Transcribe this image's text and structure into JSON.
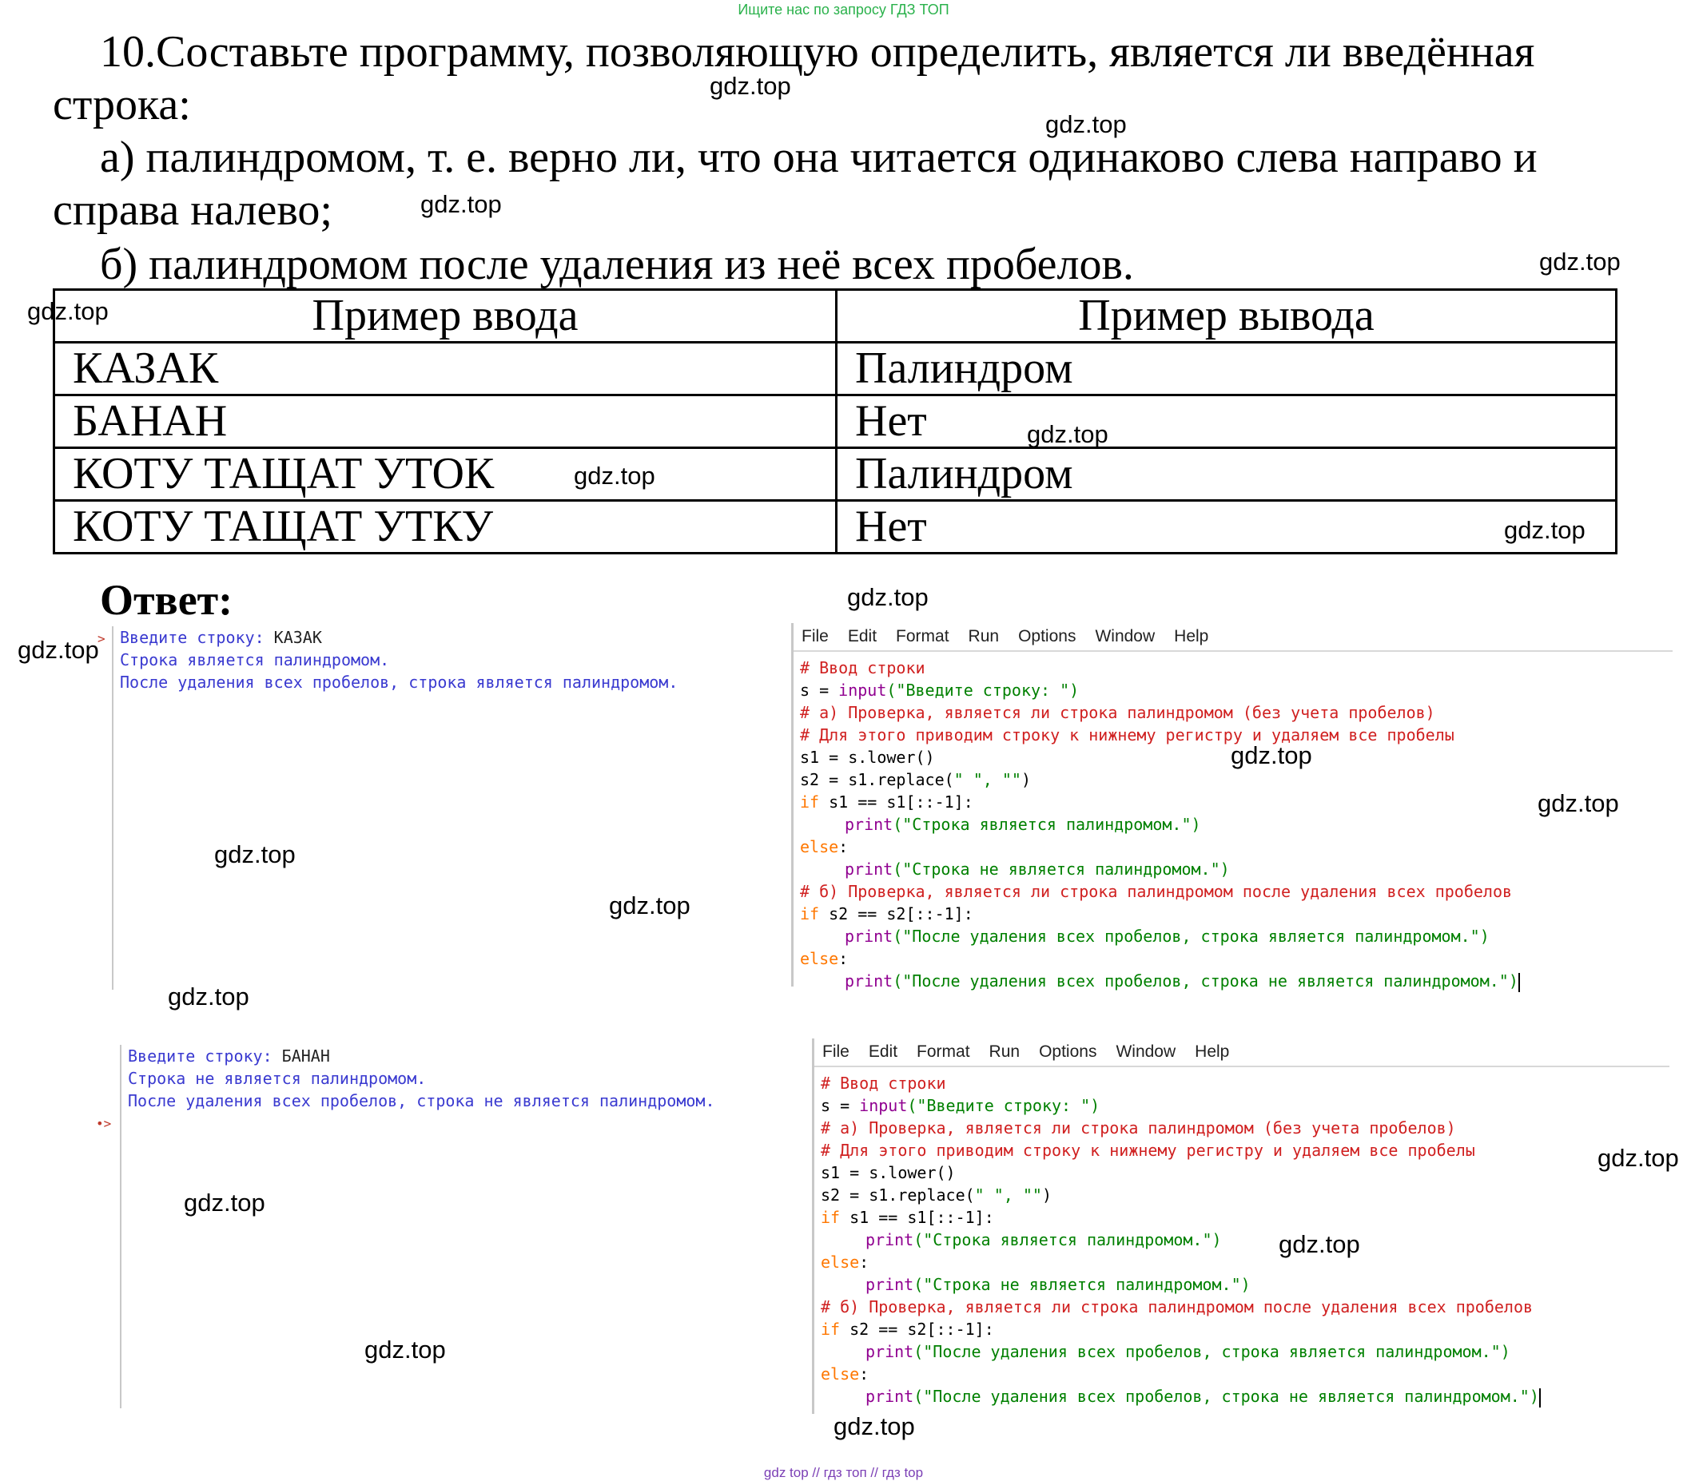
{
  "banner": "Ищите нас по запросу ГДЗ ТОП",
  "task": {
    "line1": "10.Составьте программу, позволяющую определить, является ли введённая",
    "line2": "строка:",
    "line3": "а)  палиндромом, т. е. верно ли, что она читается одинаково слева направо и",
    "line4": "справа налево;",
    "line5": "б)  палиндромом после удаления из неё всех пробелов."
  },
  "table": {
    "headers": [
      "Пример ввода",
      "Пример вывода"
    ],
    "rows": [
      [
        "КАЗАК",
        "Палиндром"
      ],
      [
        "БАНАН",
        "Нет"
      ],
      [
        "КОТУ ТАЩАТ УТОК",
        "Палиндром"
      ],
      [
        "КОТУ ТАЩАТ УТКУ",
        "Нет"
      ]
    ]
  },
  "answer_label": "Ответ:",
  "shell1": {
    "prompt_label": "Введите строку: ",
    "input_value": "КАЗАК",
    "out1": "Строка является палиндромом.",
    "out2": "После удаления всех пробелов, строка является палиндромом.",
    "prompt_marker": ">"
  },
  "shell2": {
    "prompt_label": "Введите строку: ",
    "input_value": "БАНАН",
    "out1": "Строка не является палиндромом.",
    "out2": "После удаления всех пробелов, строка не является палиндромом.",
    "prompt_marker": "•>"
  },
  "menu": [
    "File",
    "Edit",
    "Format",
    "Run",
    "Options",
    "Window",
    "Help"
  ],
  "code": {
    "c1": "# Ввод строки",
    "l2a": "s = ",
    "l2fn": "input",
    "l2str": "(\"Введите строку: \")",
    "c3": "# а) Проверка, является ли строка палиндромом (без учета пробелов)",
    "c4": "# Для этого приводим строку к нижнему регистру и удаляем все пробелы",
    "l5": "s1 = s.lower()",
    "l6a": "s2 = s1.replace(",
    "l6str": "\" \", \"\"",
    "l6b": ")",
    "kw_if": "if",
    "l7": " s1 == s1[::-1]:",
    "print": "print",
    "str8": "(\"Строка является палиндромом.\")",
    "kw_else": "else",
    "colon": ":",
    "str10": "(\"Строка не является палиндромом.\")",
    "c11": "# б) Проверка, является ли строка палиндромом после удаления всех пробелов",
    "l12": " s2 == s2[::-1]:",
    "str13": "(\"После удаления всех пробелов, строка является палиндромом.\")",
    "str15": "(\"После удаления всех пробелов, строка не является палиндромом.\")"
  },
  "watermark": "gdz.top",
  "footer": "gdz top  //  гдз топ  //  гдз top"
}
